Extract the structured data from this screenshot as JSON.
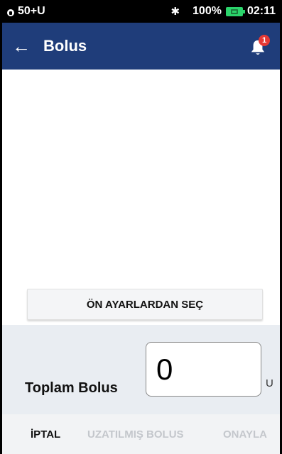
{
  "status_bar": {
    "left_text": "50+U",
    "battery_percent": "100%",
    "time": "02:11",
    "icons": [
      "lock-icon",
      "bluetooth-icon",
      "battery-charging-icon"
    ]
  },
  "app_bar": {
    "title": "Bolus",
    "notification_count": "1",
    "icons": [
      "back-arrow-icon",
      "bell-icon"
    ],
    "color": "#1f3d7a"
  },
  "presets": {
    "button_label": "ÖN AYARLARDAN SEÇ"
  },
  "total": {
    "label": "Toplam Bolus",
    "value": "0",
    "unit": "U"
  },
  "actions": {
    "cancel": "İPTAL",
    "extended": "UZATILMIŞ BOLUS",
    "confirm": "ONAYLA"
  }
}
